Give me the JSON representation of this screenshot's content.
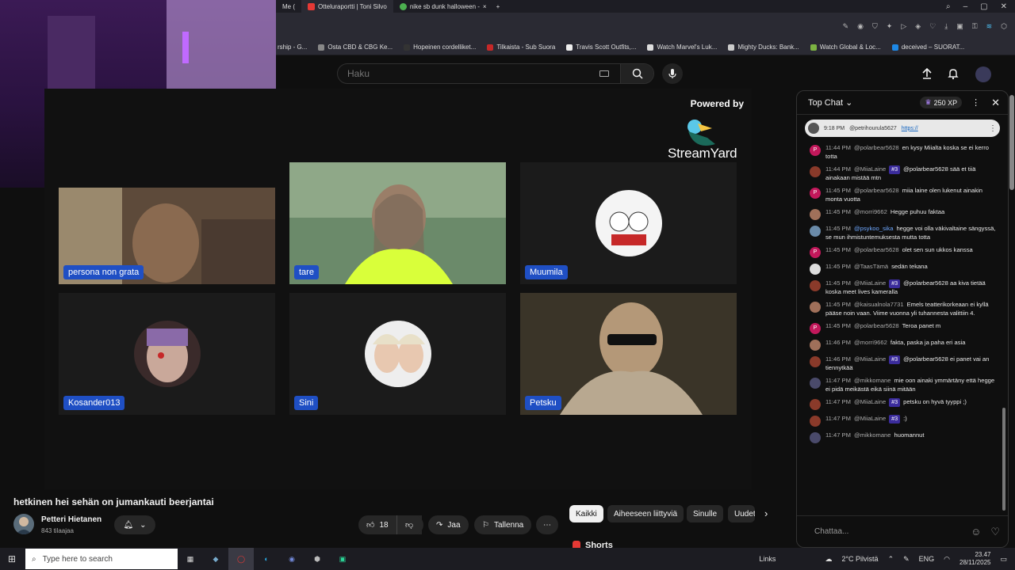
{
  "browser": {
    "tabs": [
      {
        "label": "Me ("
      },
      {
        "label": "Otteluraportti | Toni Silvo"
      },
      {
        "label": "nike sb dunk halloween -"
      }
    ],
    "bookmarks": [
      {
        "label": "rship - G..."
      },
      {
        "label": "Osta CBD & CBG Ke..."
      },
      {
        "label": "Hopeinen cordelliket..."
      },
      {
        "label": "Tilkaista - Sub Suora"
      },
      {
        "label": "Travis Scott Outfits,..."
      },
      {
        "label": "Watch Marvel's Luk..."
      },
      {
        "label": "Mighty Ducks: Bank..."
      },
      {
        "label": "Watch Global & Loc..."
      },
      {
        "label": "deceived – SUORAT..."
      }
    ]
  },
  "header": {
    "search_placeholder": "Haku"
  },
  "stream": {
    "powered_by": "Powered by",
    "brand": "StreamYard",
    "participants": [
      {
        "name": "persona non grata"
      },
      {
        "name": "tare"
      },
      {
        "name": "Muumila"
      },
      {
        "name": "Kosander013"
      },
      {
        "name": "Sini"
      },
      {
        "name": "Petsku"
      }
    ]
  },
  "video": {
    "title": "hetkinen hei sehän on jumankauti beerjantai",
    "channel": "Petteri Hietanen",
    "subscribers": "843 tilaajaa",
    "likes": "18",
    "share": "Jaa",
    "save": "Tallenna"
  },
  "chips": [
    "Kaikki",
    "Aiheeseen liittyviä",
    "Sinulle",
    "Uudet"
  ],
  "shorts": "Shorts",
  "chat": {
    "title": "Top Chat",
    "xp": "250 XP",
    "pinned_time": "9:18 PM",
    "pinned_author": "@petrihourula5627",
    "pinned_link": "https://",
    "input_placeholder": "Chattaa...",
    "messages": [
      {
        "time": "11:44 PM",
        "author": "@polarbear5628",
        "badge": "",
        "text": "en kysy Miialta koska se ei kerro totta",
        "av": "P",
        "avcolor": "#c2185b"
      },
      {
        "time": "11:44 PM",
        "author": "@MiiaLaine",
        "badge": "#3",
        "text": "@polarbear5628 sää et tiiä ainakaan mistää mtn",
        "av": "",
        "avcolor": "#8a3a2a"
      },
      {
        "time": "11:45 PM",
        "author": "@polarbear5628",
        "badge": "",
        "text": "miia laine olen lukenut ainakin monta vuotta",
        "av": "P",
        "avcolor": "#c2185b"
      },
      {
        "time": "11:45 PM",
        "author": "@morri9662",
        "badge": "",
        "text": "Hegge puhuu faktaa",
        "av": "",
        "avcolor": "#a0705a"
      },
      {
        "time": "11:45 PM",
        "author": "@psykoo_sika",
        "badge": "",
        "text": "hegge voi olla väkivaltaine sängyssä, se mun ihmistuntemuksesta mutta totta",
        "av": "",
        "avcolor": "#6a8aa8",
        "blue": true
      },
      {
        "time": "11:45 PM",
        "author": "@polarbear5628",
        "badge": "",
        "text": "olet sen sun ukkos kanssa",
        "av": "P",
        "avcolor": "#c2185b"
      },
      {
        "time": "11:45 PM",
        "author": "@TaasTämä",
        "badge": "",
        "text": "sedän tekana",
        "av": "",
        "avcolor": "#ddd"
      },
      {
        "time": "11:45 PM",
        "author": "@MiiaLaine",
        "badge": "#3",
        "text": "@polarbear5628 aa kiva tietää koska meet lives kameralla",
        "av": "",
        "avcolor": "#8a3a2a"
      },
      {
        "time": "11:45 PM",
        "author": "@kaisualnola7731",
        "badge": "",
        "text": "Emels teatterikorkeaan ei kyllä pääse noin vaan. Viime vuonna yli tuhannesta valittiin 4.",
        "av": "",
        "avcolor": "#a0705a"
      },
      {
        "time": "11:45 PM",
        "author": "@polarbear5628",
        "badge": "",
        "text": "Teroa panet m",
        "av": "P",
        "avcolor": "#c2185b"
      },
      {
        "time": "11:46 PM",
        "author": "@morri9662",
        "badge": "",
        "text": "fakta, paska ja paha eri asia",
        "av": "",
        "avcolor": "#a0705a"
      },
      {
        "time": "11:46 PM",
        "author": "@MiiaLaine",
        "badge": "#3",
        "text": "@polarbear5628 ei panet vai an tiennytkää",
        "av": "",
        "avcolor": "#8a3a2a"
      },
      {
        "time": "11:47 PM",
        "author": "@mikkomane",
        "badge": "",
        "text": "mie oon ainaki ymmärtäny että hegge ei pidä meikästä eikä siinä mitään",
        "av": "",
        "avcolor": "#4a4a6a"
      },
      {
        "time": "11:47 PM",
        "author": "@MiiaLaine",
        "badge": "#3",
        "text": "petsku on hyvä tyyppi ;)",
        "av": "",
        "avcolor": "#8a3a2a"
      },
      {
        "time": "11:47 PM",
        "author": "@MiiaLaine",
        "badge": "#3",
        "text": ":)",
        "av": "",
        "avcolor": "#8a3a2a"
      },
      {
        "time": "11:47 PM",
        "author": "@mikkomane",
        "badge": "",
        "text": "huomannut",
        "av": "",
        "avcolor": "#4a4a6a"
      }
    ]
  },
  "taskbar": {
    "search_placeholder": "Type here to search",
    "links": "Links",
    "weather": "2°C Pilvistä",
    "lang": "ENG",
    "time": "23.47",
    "date": "28/11/2025"
  }
}
